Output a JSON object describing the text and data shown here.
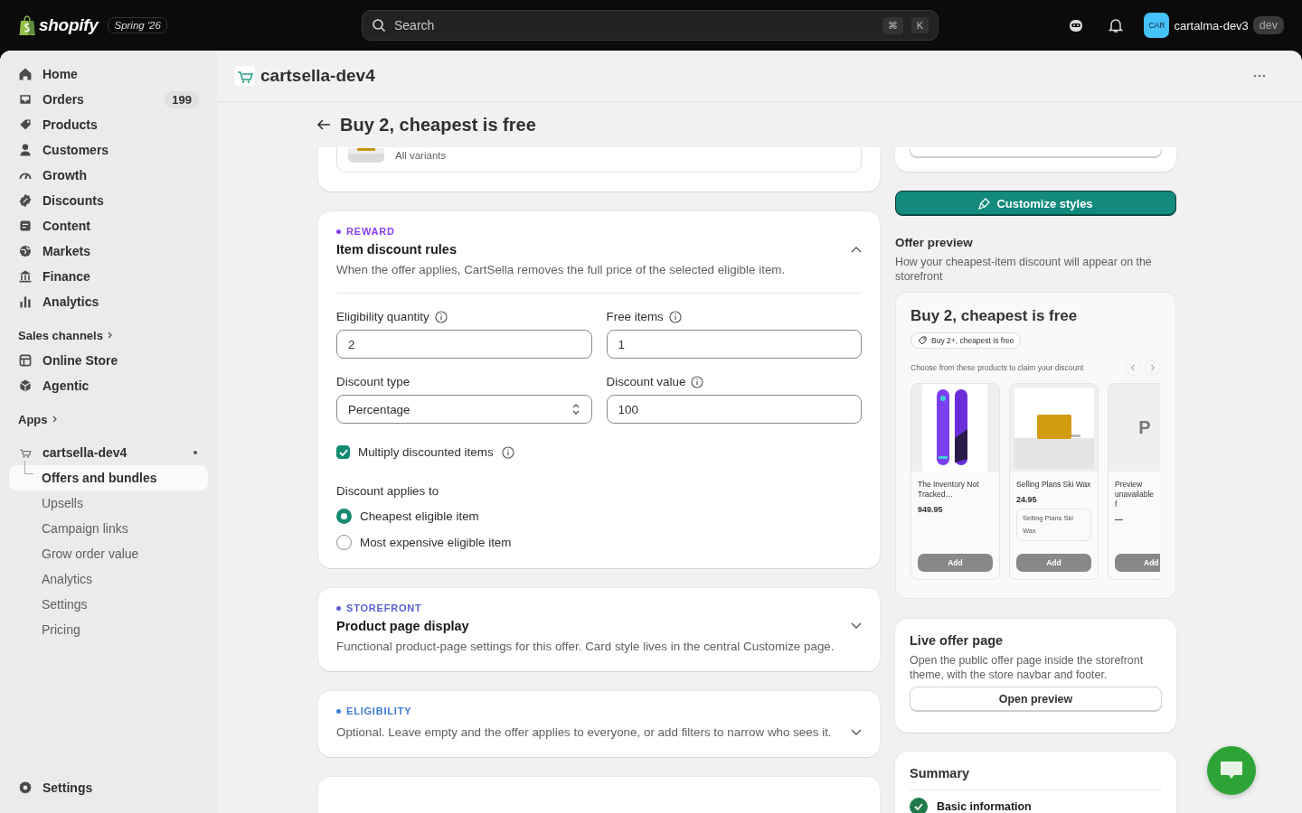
{
  "topbar": {
    "brand": "shopify",
    "edition": "Spring '26",
    "search": {
      "placeholder": "Search",
      "keys": [
        "⌘",
        "K"
      ]
    },
    "avatar": "CAR",
    "store": "cartalma-dev3",
    "store_badge": "dev"
  },
  "sidebar": {
    "items": [
      {
        "label": "Home",
        "selected": false
      },
      {
        "label": "Orders",
        "badge": "199",
        "selected": false
      },
      {
        "label": "Products",
        "selected": false
      },
      {
        "label": "Customers",
        "selected": false
      },
      {
        "label": "Growth",
        "selected": false
      },
      {
        "label": "Discounts",
        "selected": false
      },
      {
        "label": "Content",
        "selected": false
      },
      {
        "label": "Markets",
        "selected": false
      },
      {
        "label": "Finance",
        "selected": false
      },
      {
        "label": "Analytics",
        "selected": false
      }
    ],
    "sales_channels": {
      "heading": "Sales channels",
      "items": [
        {
          "label": "Online Store",
          "selected": false
        },
        {
          "label": "Agentic",
          "selected": false
        }
      ]
    },
    "apps": {
      "heading": "Apps",
      "app": {
        "label": "cartsella-dev4",
        "children": [
          {
            "label": "Offers and bundles",
            "selected": true
          },
          {
            "label": "Upsells",
            "selected": false
          },
          {
            "label": "Campaign links",
            "selected": false
          },
          {
            "label": "Grow order value",
            "selected": false
          },
          {
            "label": "Analytics",
            "selected": false
          },
          {
            "label": "Settings",
            "selected": false
          },
          {
            "label": "Pricing",
            "selected": false
          }
        ]
      }
    },
    "footer": "Settings"
  },
  "header": {
    "store": "cartsella-dev4"
  },
  "page": {
    "title": "Buy 2, cheapest is free",
    "product_card": {
      "variants": "All variants"
    },
    "sections": [
      {
        "tag": "REWARD",
        "color": "#8a3ffc",
        "title": "Item discount rules",
        "description": "When the offer applies, CartSella removes the full price of the selected eligible item.",
        "expanded": true,
        "fields": [
          {
            "label": "Eligibility quantity",
            "value": "2",
            "kind": "text"
          },
          {
            "label": "Free items",
            "value": "1",
            "kind": "text"
          },
          {
            "label": "Discount type",
            "value": "Percentage",
            "kind": "select"
          },
          {
            "label": "Discount value",
            "value": "100",
            "kind": "text"
          }
        ],
        "checkbox": {
          "label": "Multiply discounted items",
          "checked": true
        },
        "radio_group": {
          "label": "Discount applies to",
          "options": [
            {
              "label": "Cheapest eligible item",
              "selected": true
            },
            {
              "label": "Most expensive eligible item",
              "selected": false
            }
          ]
        }
      },
      {
        "tag": "STOREFRONT",
        "color": "#5a5fd8",
        "title": "Product page display",
        "description": "Functional product-page settings for this offer. Card style lives in the central Customize page.",
        "expanded": false
      },
      {
        "tag": "ELIGIBILITY",
        "color": "#3d7bd9",
        "description": "Optional. Leave empty and the offer applies to everyone, or add filters to narrow who sees it.",
        "expanded": false
      }
    ]
  },
  "aside": {
    "customize_button": "Customize styles",
    "preview": {
      "title": "Offer preview",
      "description": "How your cheapest-item discount will appear on the storefront",
      "card_title": "Buy 2, cheapest is free",
      "tag": "Buy 2+, cheapest is free",
      "prompt": "Choose from these products to claim your discount",
      "products": [
        {
          "kind": "picture",
          "name": "The Inventory Not Tracked…",
          "price": "949.95",
          "button": "Add"
        },
        {
          "kind": "picture",
          "name": "Selling Plans Ski Wax",
          "price": "24.95",
          "variant": "Selling Plans Ski Wax",
          "button": "Add"
        },
        {
          "kind": "placeholder",
          "letter": "P",
          "name": "Preview unavailable f",
          "price": "—",
          "button": "Add"
        }
      ]
    },
    "live_page": {
      "title": "Live offer page",
      "description": "Open the public offer page inside the storefront theme, with the store navbar and footer.",
      "button": "Open preview"
    },
    "summary": {
      "title": "Summary",
      "items": [
        {
          "label": "Basic information",
          "done": true
        }
      ]
    }
  }
}
